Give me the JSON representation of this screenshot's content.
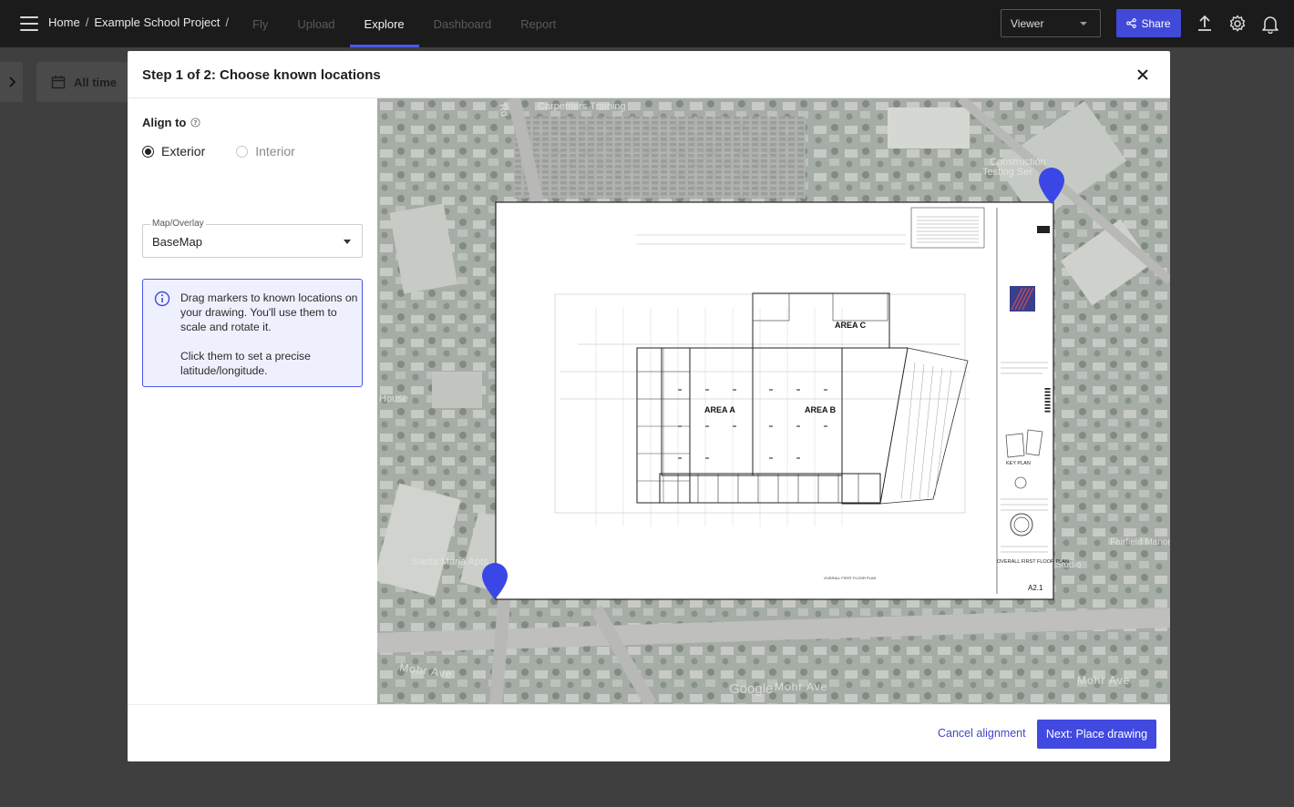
{
  "nav": {
    "breadcrumb_home": "Home",
    "breadcrumb_sep": "/",
    "breadcrumb_project": "Example School Project",
    "breadcrumb_sep2": "/",
    "tabs": [
      {
        "label": "Fly",
        "active": false
      },
      {
        "label": "Upload",
        "active": false
      },
      {
        "label": "Explore",
        "active": true
      },
      {
        "label": "Dashboard",
        "active": false
      },
      {
        "label": "Report",
        "active": false
      }
    ],
    "viewer_select": "Viewer",
    "share_label": "Share",
    "icons": [
      "menu-icon",
      "upload-icon",
      "gear-icon",
      "bell-icon",
      "share-icon"
    ]
  },
  "background": {
    "date_filter": "All time"
  },
  "modal": {
    "title": "Step 1 of 2: Choose known locations",
    "align_to_label": "Align to",
    "align_options": [
      {
        "label": "Exterior",
        "selected": true
      },
      {
        "label": "Interior",
        "selected": false
      }
    ],
    "map_overlay_label": "Map/Overlay",
    "map_overlay_value": "BaseMap",
    "info_line1": "Drag markers to known locations on your drawing. You'll use them to scale and rotate it.",
    "info_line2": "Click them to set a precise latitude/longitude.",
    "cancel_label": "Cancel alignment",
    "next_label": "Next: Place drawing"
  },
  "map": {
    "labels": {
      "rd": "Rd",
      "carpenters": "Carpenters Training",
      "construction": "Construction",
      "testing": "Testing Ser",
      "santa_maria": "Santa Maria Apts",
      "house": "House",
      "mohr_ave_1": "Mohr Ave",
      "mohr_ave_2": "Mohr Ave",
      "mohr_ave_3": "Mohr Ave",
      "google": "Google",
      "fairfield": "Fairfield Manor Care",
      "studio": "Studio"
    },
    "drawing": {
      "area_a": "AREA A",
      "area_b": "AREA B",
      "area_c": "AREA C",
      "key_plan": "KEY PLAN",
      "sheet_title": "OVERALL FIRST FLOOR PLAN",
      "sheet_number": "A2.1",
      "cover_label": "OVERALL FIRST FLOOR PLAN"
    },
    "markers": [
      "marker-top-right",
      "marker-bottom-left"
    ],
    "marker_color": "#3a47e6"
  }
}
